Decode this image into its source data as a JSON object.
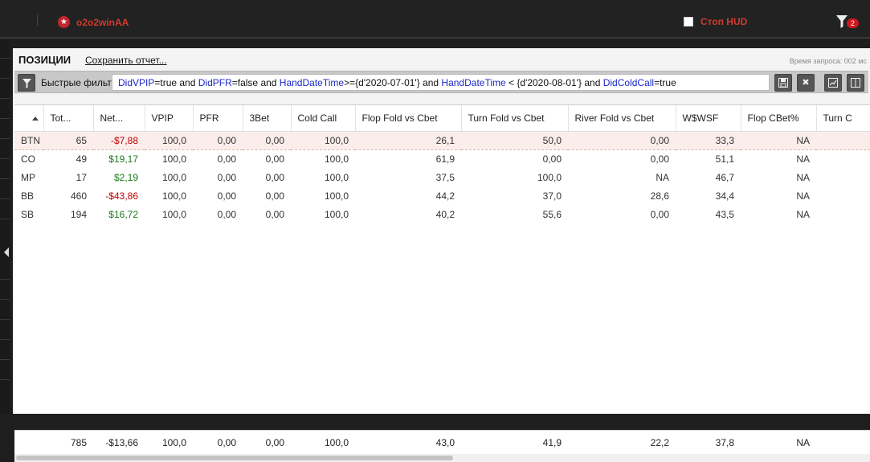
{
  "app": {
    "username": "o2o2winAA",
    "hud_label": "Стоп HUD",
    "filter_badge": "2"
  },
  "panel": {
    "title": "ПОЗИЦИИ",
    "save_report": "Сохранить отчет...",
    "query_time": "Время запроса: 002 мс"
  },
  "filter": {
    "label": "Быстрые фильт",
    "query_parts": [
      {
        "t": "DidVPIP",
        "kw": true
      },
      {
        "t": "=true and ",
        "kw": false
      },
      {
        "t": "DidPFR",
        "kw": true
      },
      {
        "t": "=false and ",
        "kw": false
      },
      {
        "t": "HandDateTime",
        "kw": true
      },
      {
        "t": ">={d'2020-07-01'} and ",
        "kw": false
      },
      {
        "t": "HandDateTime",
        "kw": true
      },
      {
        "t": " < {d'2020-08-01'} and ",
        "kw": false
      },
      {
        "t": "DidColdCall",
        "kw": true
      },
      {
        "t": "=true",
        "kw": false
      }
    ]
  },
  "table": {
    "columns": [
      "",
      "Tot...",
      "Net...",
      "VPIP",
      "PFR",
      "3Bet",
      "Cold Call",
      "Flop Fold vs Cbet",
      "Turn Fold vs Cbet",
      "River Fold vs Cbet",
      "W$WSF",
      "Flop CBet%",
      "Turn C"
    ],
    "rows": [
      {
        "pos": "BTN",
        "tot": "65",
        "net": "-$7,88",
        "net_sign": "neg",
        "vpip": "100,0",
        "pfr": "0,00",
        "bet3": "0,00",
        "cc": "100,0",
        "ffc": "26,1",
        "tfc": "50,0",
        "rfc": "0,00",
        "wwsf": "33,3",
        "fcb": "NA",
        "selected": true
      },
      {
        "pos": "CO",
        "tot": "49",
        "net": "$19,17",
        "net_sign": "pos",
        "vpip": "100,0",
        "pfr": "0,00",
        "bet3": "0,00",
        "cc": "100,0",
        "ffc": "61,9",
        "tfc": "0,00",
        "rfc": "0,00",
        "wwsf": "51,1",
        "fcb": "NA"
      },
      {
        "pos": "MP",
        "tot": "17",
        "net": "$2,19",
        "net_sign": "pos",
        "vpip": "100,0",
        "pfr": "0,00",
        "bet3": "0,00",
        "cc": "100,0",
        "ffc": "37,5",
        "tfc": "100,0",
        "rfc": "NA",
        "wwsf": "46,7",
        "fcb": "NA"
      },
      {
        "pos": "BB",
        "tot": "460",
        "net": "-$43,86",
        "net_sign": "neg",
        "vpip": "100,0",
        "pfr": "0,00",
        "bet3": "0,00",
        "cc": "100,0",
        "ffc": "44,2",
        "tfc": "37,0",
        "rfc": "28,6",
        "wwsf": "34,4",
        "fcb": "NA"
      },
      {
        "pos": "SB",
        "tot": "194",
        "net": "$16,72",
        "net_sign": "pos",
        "vpip": "100,0",
        "pfr": "0,00",
        "bet3": "0,00",
        "cc": "100,0",
        "ffc": "40,2",
        "tfc": "55,6",
        "rfc": "0,00",
        "wwsf": "43,5",
        "fcb": "NA"
      }
    ],
    "totals": {
      "tot": "785",
      "net": "-$13,66",
      "vpip": "100,0",
      "pfr": "0,00",
      "bet3": "0,00",
      "cc": "100,0",
      "ffc": "43,0",
      "tfc": "41,9",
      "rfc": "22,2",
      "wwsf": "37,8",
      "fcb": "NA"
    }
  },
  "icons": {
    "logo": "pokerstars-star-icon",
    "hud_toggle": "checkbox-icon",
    "filter": "funnel-icon",
    "save": "save-icon",
    "clear": "close-icon",
    "graph": "line-chart-icon",
    "layout": "columns-icon"
  },
  "colors": {
    "accent": "#d23a2e",
    "negative": "#c00000",
    "positive": "#1b7a1b",
    "keyword": "#1a28c8"
  }
}
